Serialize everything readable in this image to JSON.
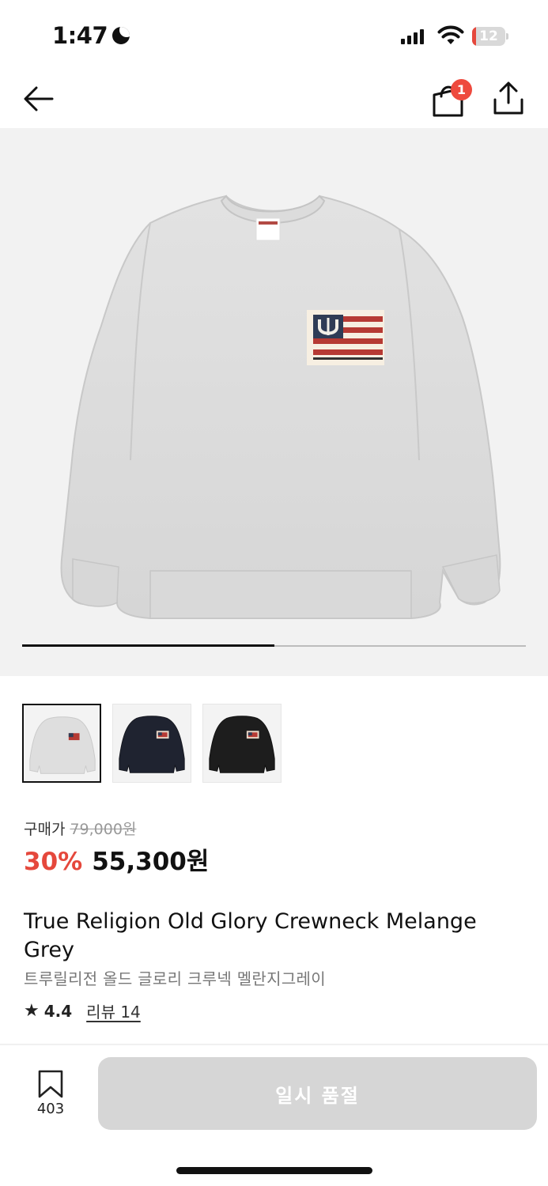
{
  "status_bar": {
    "time": "1:47",
    "battery_level": "12",
    "battery_fraction": 0.12,
    "battery_color": "#e5483c"
  },
  "nav": {
    "cart_count": "1",
    "icons": [
      "back-arrow-icon",
      "shopping-bag-icon",
      "share-icon"
    ],
    "badge_color": "#ee4a3e"
  },
  "gallery": {
    "progress_fraction": 0.5,
    "thumbnails": [
      {
        "color": "grey",
        "selected": true
      },
      {
        "color": "navy",
        "selected": false
      },
      {
        "color": "black",
        "selected": false
      }
    ]
  },
  "price": {
    "label": "구매가",
    "original": "79,000원",
    "discount": "30%",
    "sale": "55,300원",
    "accent_color": "#e5483c"
  },
  "product": {
    "title": "True Religion Old Glory Crewneck Melange Grey",
    "subtitle": "트루릴리전 올드 글로리 크루넥 멜란지그레이",
    "rating": "4.4",
    "review_link": "리뷰 14"
  },
  "bottom": {
    "wish_count": "403",
    "button_label": "일시 품절"
  }
}
